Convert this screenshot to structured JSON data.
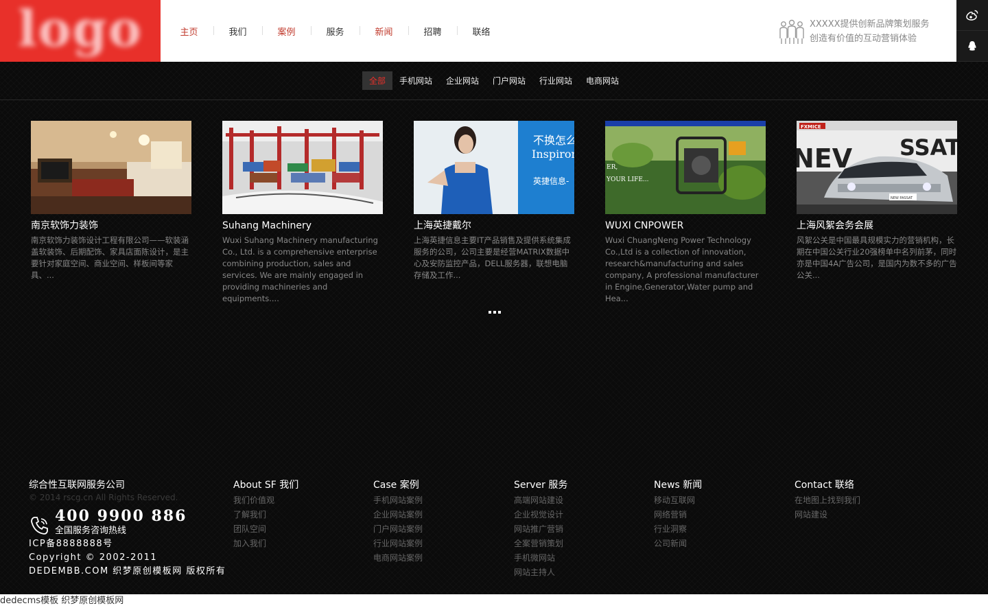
{
  "header": {
    "logo_text": "logo",
    "nav": [
      {
        "label": "主页",
        "active": true
      },
      {
        "label": "我们",
        "active": false
      },
      {
        "label": "案例",
        "active": true
      },
      {
        "label": "服务",
        "active": false
      },
      {
        "label": "新闻",
        "active": true
      },
      {
        "label": "招聘",
        "active": false
      },
      {
        "label": "联络",
        "active": false
      }
    ],
    "slogan_line1": "XXXXX提供创新品牌策划服务",
    "slogan_line2": "创造有价值的互动营销体验"
  },
  "sidebar": {
    "icons": [
      "weibo-icon",
      "qq-icon"
    ]
  },
  "filters": [
    "全部",
    "手机网站",
    "企业网站",
    "门户网站",
    "行业网站",
    "电商网站"
  ],
  "cases": [
    {
      "title": "南京软饰力装饰",
      "desc": "南京软饰力装饰设计工程有限公司——软装涵盖软装饰、后期配饰、家具店面陈设计，是主要针对家庭空间、商业空间、样板间等家具、..."
    },
    {
      "title": "Suhang Machinery",
      "desc": "Wuxi Suhang Machinery manufacturing Co., Ltd. is a comprehensive enterprise combining production, sales and services. We are mainly engaged in providing machineries and equipments...."
    },
    {
      "title": "上海英捷戴尔",
      "desc": "上海英捷信息主要IT产品销售及提供系统集成服务的公司，公司主要是经营MATRIX数据中心及安防监控产品，DELL服务器，联想电脑存储及工作..."
    },
    {
      "title": "WUXI CNPOWER",
      "desc": "Wuxi ChuangNeng Power Technology Co.,Ltd is a collection of innovation, research&manufacturing and sales company, A professional manufacturer in Engine,Generator,Water pump and Hea..."
    },
    {
      "title": "上海风絮会务会展",
      "desc": "风絮公关是中国最具规模实力的营销机构，长期在中国公关行业20强榜单中名列前茅，同时亦是中国4A广告公司，是国内为数不多的广告公关..."
    }
  ],
  "thumb_text": {
    "ad_line1": "不换怎么",
    "ad_line2": "Inspiron",
    "ad_line3": "英捷信息-",
    "plant_text1": "ER,",
    "plant_text2": "YOUR LIFE...",
    "car_brand": "FXMICE",
    "car_banner": "NEV",
    "car_banner2": "SSAT",
    "car_plate": "NEW PASSAT"
  },
  "footer": {
    "company_name": "综合性互联网服务公司",
    "copyright_small": "© 2014 rscg.cn All Rights Reserved.",
    "hotline_number": "400 9900 886",
    "hotline_label": "全国服务咨询热线",
    "icp": "ICP备8888888号",
    "copyright": "Copyright © 2002-2011",
    "dede": "DEDEMBB.COM 织梦原创模板网 版权所有",
    "columns": [
      {
        "title": "About SF 我们",
        "links": [
          "我们价值观",
          "了解我们",
          "团队空间",
          "加入我们"
        ]
      },
      {
        "title": "Case 案例",
        "links": [
          "手机网站案例",
          "企业网站案例",
          "门户网站案例",
          "行业网站案例",
          "电商网站案例"
        ]
      },
      {
        "title": "Server 服务",
        "links": [
          "高端网站建设",
          "企业视觉设计",
          "网站推广营销",
          "全案营销策划",
          "手机微网站",
          "网站主持人"
        ]
      },
      {
        "title": "News 新闻",
        "links": [
          "移动互联网",
          "网络营销",
          "行业洞察",
          "公司新闻"
        ]
      },
      {
        "title": "Contact 联络",
        "links": [
          "在地图上找到我们",
          "网站建设"
        ]
      }
    ]
  },
  "bottom_bar": "dedecms模板 织梦原创模板网",
  "colors": {
    "accent": "#e8302a",
    "nav_active": "#c0392b",
    "background": "#0b0b0b"
  }
}
